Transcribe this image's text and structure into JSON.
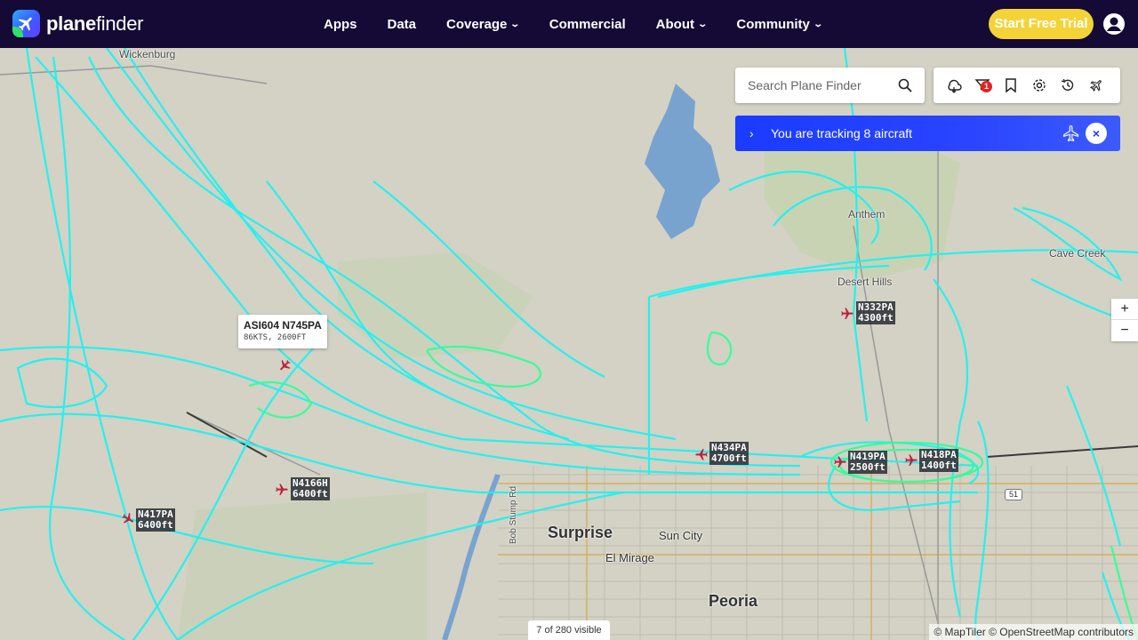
{
  "brand": {
    "name_bold": "plane",
    "name_light": "finder"
  },
  "nav": {
    "items": [
      {
        "label": "Apps",
        "dropdown": false
      },
      {
        "label": "Data",
        "dropdown": false
      },
      {
        "label": "Coverage",
        "dropdown": true
      },
      {
        "label": "Commercial",
        "dropdown": false
      },
      {
        "label": "About",
        "dropdown": true
      },
      {
        "label": "Community",
        "dropdown": true
      }
    ],
    "trial_label": "Start Free Trial"
  },
  "search": {
    "placeholder": "Search Plane Finder"
  },
  "toolbar": {
    "icons": [
      "weather-icon",
      "filter-icon",
      "bookmark-icon",
      "settings-icon",
      "history-icon",
      "ar-plane-icon"
    ],
    "filter_badge": "1"
  },
  "tracking": {
    "message": "You are tracking 8 aircraft",
    "close_label": "×"
  },
  "zoom": {
    "in": "+",
    "out": "−"
  },
  "places": [
    {
      "name": "Wickenburg",
      "size": "small"
    },
    {
      "name": "Anthem",
      "size": "small"
    },
    {
      "name": "Cave Creek",
      "size": "small"
    },
    {
      "name": "Desert Hills",
      "size": "small"
    },
    {
      "name": "Surprise",
      "size": "big"
    },
    {
      "name": "Sun City",
      "size": "mid"
    },
    {
      "name": "El Mirage",
      "size": "mid"
    },
    {
      "name": "Peoria",
      "size": "big"
    },
    {
      "name": "Bob Stump Rd",
      "size": "road"
    }
  ],
  "popup": {
    "title": "ASI604 N745PA",
    "detail": "86KTS, 2600FT"
  },
  "aircraft": [
    {
      "callsign": "N332PA",
      "altitude": "4300ft"
    },
    {
      "callsign": "N434PA",
      "altitude": "4700ft"
    },
    {
      "callsign": "N419PA",
      "altitude": "2500ft"
    },
    {
      "callsign": "N418PA",
      "altitude": "1400ft"
    },
    {
      "callsign": "N4166H",
      "altitude": "6400ft"
    },
    {
      "callsign": "N417PA",
      "altitude": "6400ft"
    }
  ],
  "road_shield": "51",
  "visible_count": "7 of 280 visible",
  "attribution": "© MapTiler © OpenStreetMap contributors",
  "colors": {
    "nav_bg": "#150a35",
    "trail_cyan": "#1df2f2",
    "trail_green": "#2fff9a",
    "trial_yellow": "#f4d338",
    "tracking_blue": "#1a3cff",
    "plane_red": "#c0203a"
  }
}
